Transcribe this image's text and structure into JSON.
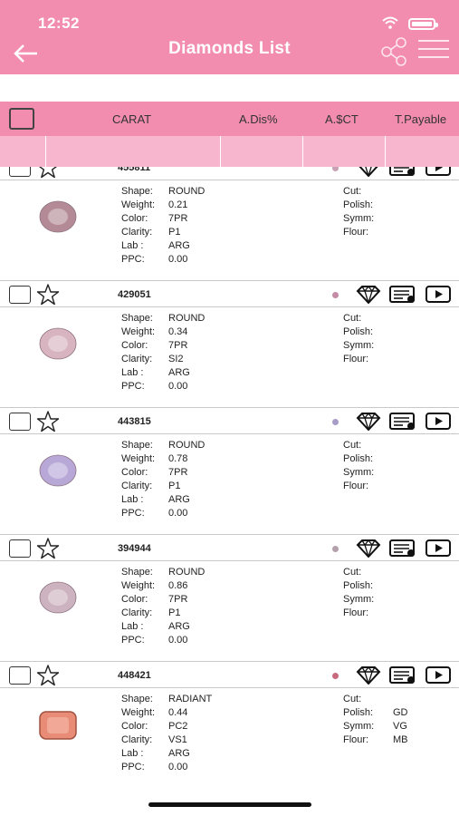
{
  "status_bar": {
    "time": "12:52"
  },
  "header": {
    "title": "Diamonds List"
  },
  "columns": [
    "CARAT",
    "A.Dis%",
    "A.$CT",
    "T.Payable"
  ],
  "detail_labels": {
    "shape": "Shape:",
    "weight": "Weight:",
    "color": "Color:",
    "clarity": "Clarity:",
    "lab": "Lab :",
    "ppc": "PPC:",
    "cut": "Cut:",
    "polish": "Polish:",
    "symm": "Symm:",
    "flour": "Flour:"
  },
  "items": [
    {
      "stock_no": "455811",
      "dot_color": "#c9a0b4",
      "stone_color": "#b38a95",
      "shape": "ROUND",
      "weight": "0.21",
      "color": "7PR",
      "clarity": "P1",
      "lab": "ARG",
      "ppc": "0.00",
      "cut": "",
      "polish": "",
      "symm": "",
      "flour": ""
    },
    {
      "stock_no": "429051",
      "dot_color": "#c48aa6",
      "stone_color": "#d7b4c0",
      "shape": "ROUND",
      "weight": "0.34",
      "color": "7PR",
      "clarity": "SI2",
      "lab": "ARG",
      "ppc": "0.00",
      "cut": "",
      "polish": "",
      "symm": "",
      "flour": ""
    },
    {
      "stock_no": "443815",
      "dot_color": "#a89cc8",
      "stone_color": "#b7a8d8",
      "shape": "ROUND",
      "weight": "0.78",
      "color": "7PR",
      "clarity": "P1",
      "lab": "ARG",
      "ppc": "0.00",
      "cut": "",
      "polish": "",
      "symm": "",
      "flour": ""
    },
    {
      "stock_no": "394944",
      "dot_color": "#b4a0ac",
      "stone_color": "#cdb3bf",
      "shape": "ROUND",
      "weight": "0.86",
      "color": "7PR",
      "clarity": "P1",
      "lab": "ARG",
      "ppc": "0.00",
      "cut": "",
      "polish": "",
      "symm": "",
      "flour": ""
    },
    {
      "stock_no": "448421",
      "dot_color": "#c86a7e",
      "stone_color": "#e88c78",
      "shape": "RADIANT",
      "weight": "0.44",
      "color": "PC2",
      "clarity": "VS1",
      "lab": "ARG",
      "ppc": "0.00",
      "cut": "",
      "polish": "GD",
      "symm": "VG",
      "flour": "MB"
    }
  ],
  "colors": {
    "brand_pink": "#f28db0",
    "filter_pink": "#f7b6cd"
  }
}
